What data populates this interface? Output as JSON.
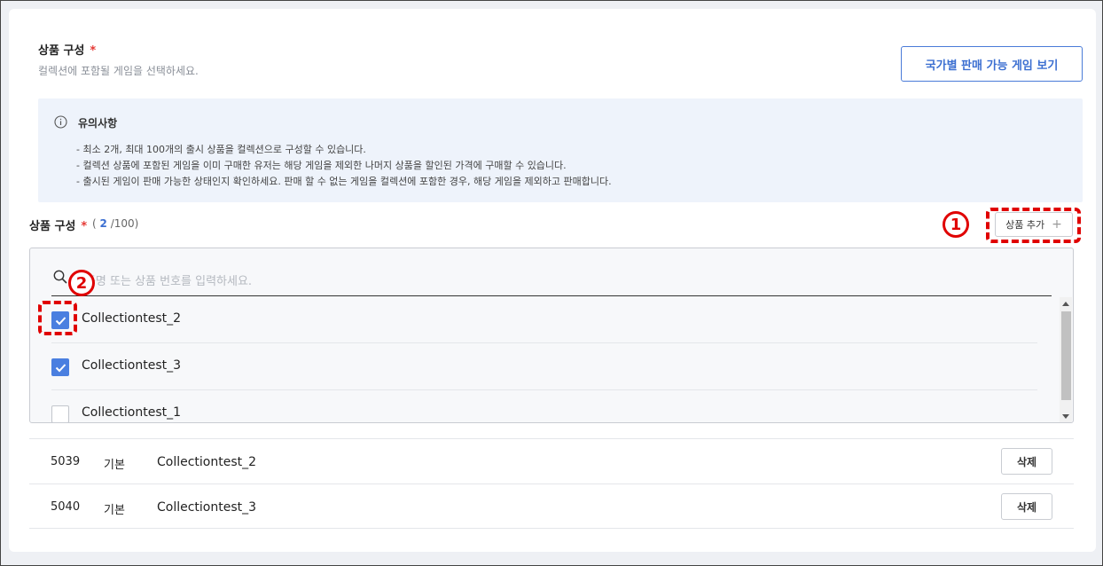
{
  "section": {
    "title": "상품 구성",
    "required_mark": "*",
    "description": "컬렉션에 포함될 게임을 선택하세요.",
    "country_button": "국가별 판매 가능 게임 보기"
  },
  "notice": {
    "icon": "info-icon",
    "title": "유의사항",
    "items": [
      "- 최소 2개, 최대 100개의 출시 상품을 컬렉션으로 구성할 수 있습니다.",
      "- 컬렉션 상품에 포함된 게임을 이미 구매한 유저는 해당 게임을 제외한 나머지 상품을 할인된 가격에 구매할 수 있습니다.",
      "- 출시된 게임이 판매 가능한 상태인지 확인하세요. 판매 할 수 없는 게임을 컬렉션에 포함한 경우, 해당 게임을 제외하고 판매합니다."
    ]
  },
  "composition": {
    "title": "상품 구성",
    "required_mark": "*",
    "count_open": "(",
    "count_current": "2",
    "count_max": "/100)",
    "add_button": "상품 추가",
    "add_icon": "plus-icon"
  },
  "annotations": {
    "marker_1": "1",
    "marker_2": "2",
    "color": "#e00000"
  },
  "dropdown": {
    "search_placeholder": "상품명 또는 상품 번호를 입력하세요.",
    "search_value": "",
    "options": [
      {
        "label": "Collectiontest_2",
        "checked": true
      },
      {
        "label": "Collectiontest_3",
        "checked": true
      },
      {
        "label": "Collectiontest_1",
        "checked": false
      }
    ]
  },
  "table": {
    "rows": [
      {
        "id": "5039",
        "type": "기본",
        "name": "Collectiontest_2",
        "action": "삭제"
      },
      {
        "id": "5040",
        "type": "기본",
        "name": "Collectiontest_3",
        "action": "삭제"
      }
    ]
  },
  "colors": {
    "accent": "#3c6fd1",
    "checkbox": "#4a7fe0",
    "required": "#e53935",
    "notice_bg": "#eef3fb"
  }
}
